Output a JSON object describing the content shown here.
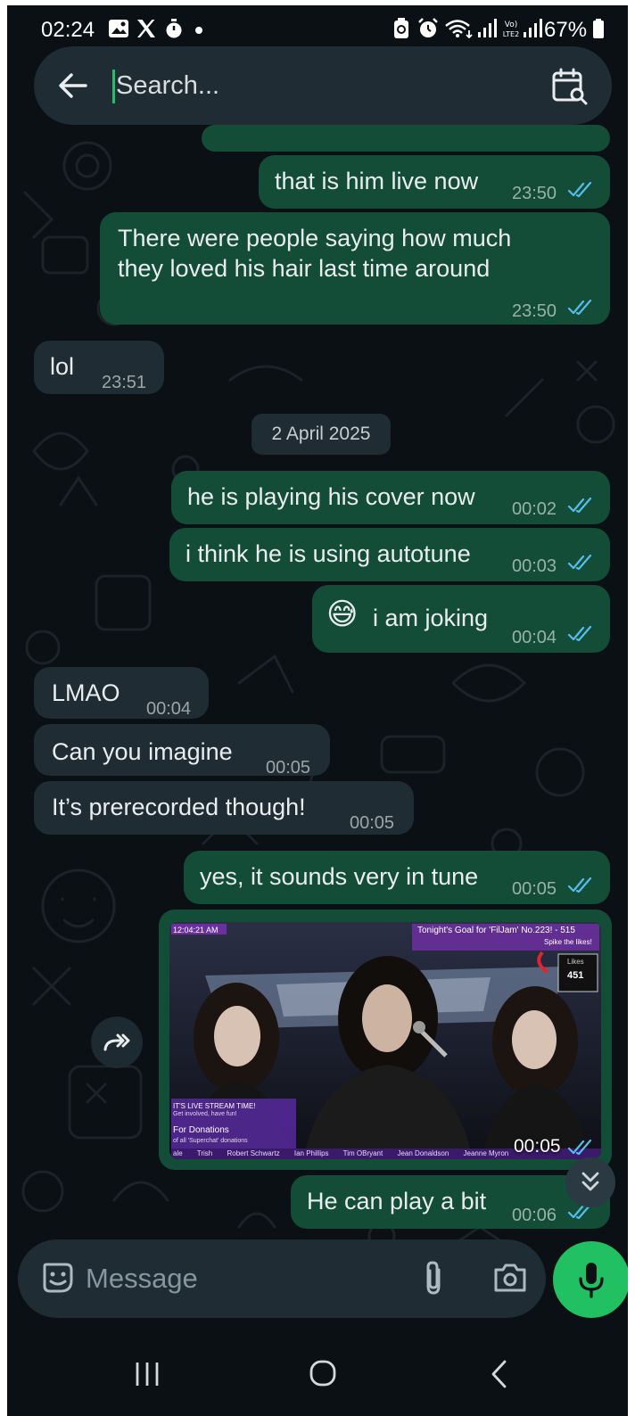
{
  "status_bar": {
    "time": "02:24",
    "battery": "67%",
    "network_label": "Vo) LTE2",
    "icons": [
      "gallery-icon",
      "x-icon",
      "timer-icon",
      "dot-icon",
      "battery-saver-icon",
      "alarm-icon",
      "wifi-icon",
      "signal-icon",
      "battery-icon"
    ]
  },
  "search": {
    "placeholder": "Search..."
  },
  "messages": [
    {
      "direction": "outgoing",
      "text": "that is him live now",
      "time": "23:50",
      "status": "read"
    },
    {
      "direction": "outgoing",
      "text_lines": [
        "There were people saying how much",
        "they loved his hair last time around"
      ],
      "time": "23:50",
      "status": "read"
    },
    {
      "direction": "incoming",
      "text": "lol",
      "time": "23:51"
    },
    {
      "direction": "outgoing",
      "text": "he is playing his cover now",
      "time": "00:02",
      "status": "read"
    },
    {
      "direction": "outgoing",
      "text": "i think he is using autotune",
      "time": "00:03",
      "status": "read"
    },
    {
      "direction": "outgoing",
      "emoji": "😅",
      "text": "i am joking",
      "time": "00:04",
      "status": "read"
    },
    {
      "direction": "incoming",
      "text": "LMAO",
      "time": "00:04"
    },
    {
      "direction": "incoming",
      "text": "Can you imagine",
      "time": "00:05"
    },
    {
      "direction": "incoming",
      "text": "It’s prerecorded though!",
      "time": "00:05"
    },
    {
      "direction": "outgoing",
      "text": "yes, it sounds very in tune",
      "time": "00:05",
      "status": "read"
    },
    {
      "direction": "outgoing",
      "text": "He can play a bit",
      "time": "00:06",
      "status": "read"
    }
  ],
  "date_separator": "2 April 2025",
  "video": {
    "time": "00:05",
    "status": "read",
    "overlay": {
      "clock": "12:04:21 AM",
      "goal_text": "Tonight's Goal for 'FilJam' No.223! - 515",
      "spike_text": "Spike the likes!",
      "likes_label": "Likes",
      "likes_count": "451",
      "stream_time_title": "IT'S LIVE STREAM TIME!",
      "stream_time_sub": "Get involved, have fun!",
      "donations_title": "For Donations",
      "donations_sub": "of all 'Superchat' donations",
      "ticker": [
        "ale",
        "Trish",
        "Robert Schwartz",
        "Ian Phillips",
        "Tim OBryant",
        "Jean Donaldson",
        "Jeanne Myron"
      ]
    }
  },
  "composer": {
    "placeholder": "Message"
  },
  "colors": {
    "background": "#0b1014",
    "outgoing_bubble": "#144d37",
    "incoming_bubble": "#1f2c34",
    "accent": "#21c063",
    "read_ticks": "#53bdeb"
  }
}
